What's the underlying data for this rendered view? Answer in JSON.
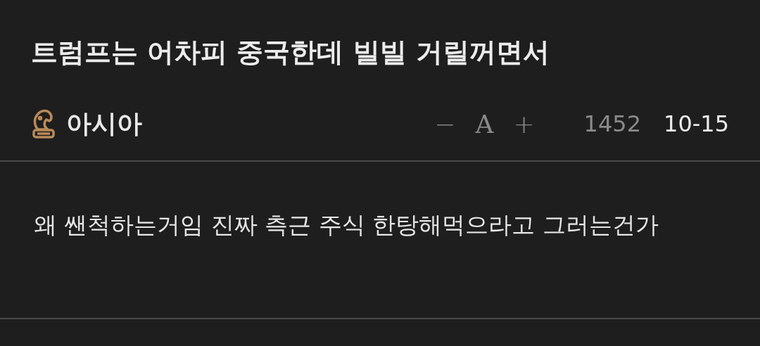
{
  "post": {
    "title": "트럼프는 어차피 중국한데 빌빌 거릴꺼면서",
    "author": "아시아",
    "font_controls": [
      "−",
      "A",
      "+"
    ],
    "views": "1452",
    "date": "10-15",
    "body": "왜 쌘척하는거임 진짜 측근 주식 한탕해먹으라고 그러는건가"
  }
}
